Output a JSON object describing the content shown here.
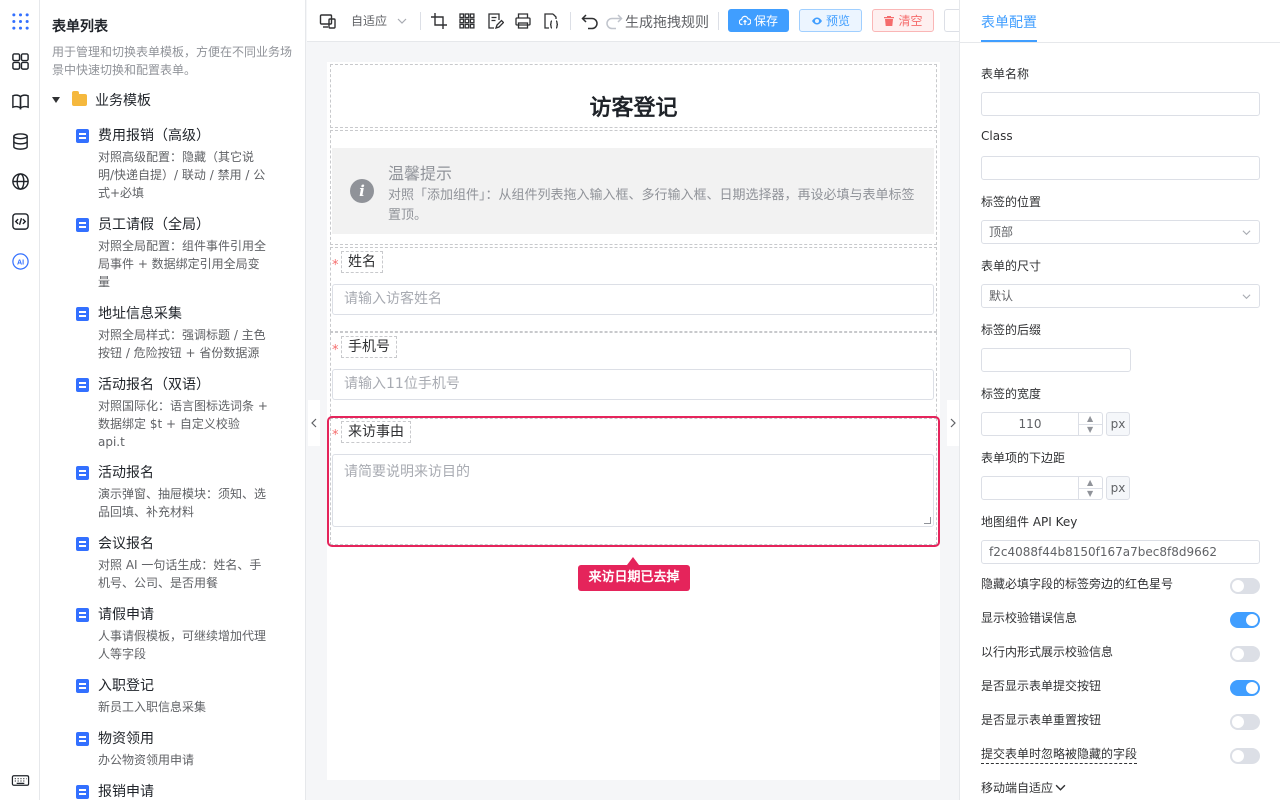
{
  "sidebar": {
    "title": "表单列表",
    "description": "用于管理和切换表单模板，方便在不同业务场景中快速切换和配置表单。",
    "folder": "业务模板",
    "templates": [
      {
        "name": "费用报销（高级）",
        "desc": "对照高级配置：隐藏（其它说明/快递自提）/ 联动 / 禁用 / 公式+必填"
      },
      {
        "name": "员工请假（全局）",
        "desc": "对照全局配置：组件事件引用全局事件 + 数据绑定引用全局变量"
      },
      {
        "name": "地址信息采集",
        "desc": "对照全局样式：强调标题 / 主色按钮 / 危险按钮 + 省份数据源"
      },
      {
        "name": "活动报名（双语）",
        "desc": "对照国际化：语言图标选词条 + 数据绑定 $t + 自定义校验 api.t"
      },
      {
        "name": "活动报名",
        "desc": "演示弹窗、抽屉模块：须知、选品回填、补充材料"
      },
      {
        "name": "会议报名",
        "desc": "对照 AI 一句话生成：姓名、手机号、公司、是否用餐"
      },
      {
        "name": "请假申请",
        "desc": "人事请假模板，可继续增加代理人等字段"
      },
      {
        "name": "入职登记",
        "desc": "新员工入职信息采集"
      },
      {
        "name": "物资领用",
        "desc": "办公物资领用申请"
      },
      {
        "name": "报销申请",
        "desc": ""
      }
    ]
  },
  "toolbar": {
    "device_mode": "自适应",
    "generate_rules": "生成拖拽规则",
    "save": "保存",
    "preview": "预览",
    "clear": "清空"
  },
  "canvas": {
    "form_title": "访客登记",
    "tip_title": "温馨提示",
    "tip_text": "对照「添加组件」：从组件列表拖入输入框、多行输入框、日期选择器，再设必填与表单标签置顶。",
    "fields": [
      {
        "label": "姓名",
        "placeholder": "请输入访客姓名",
        "required": true
      },
      {
        "label": "手机号",
        "placeholder": "请输入11位手机号",
        "required": true
      },
      {
        "label": "来访事由",
        "placeholder": "请简要说明来访目的",
        "required": true
      }
    ],
    "required_mark": "*",
    "annotation": "来访日期已去掉",
    "info_glyph": "i"
  },
  "panel": {
    "tab": "表单配置",
    "form_name_label": "表单名称",
    "form_name_value": "",
    "class_label": "Class",
    "class_value": "",
    "label_position_label": "标签的位置",
    "label_position_value": "顶部",
    "form_size_label": "表单的尺寸",
    "form_size_value": "默认",
    "label_suffix_label": "标签的后缀",
    "label_suffix_value": "",
    "label_width_label": "标签的宽度",
    "label_width_value": "110",
    "unit": "px",
    "item_margin_label": "表单项的下边距",
    "item_margin_value": "",
    "api_key_label": "地图组件 API Key",
    "api_key_value": "f2c4088f44b8150f167a7bec8f8d9662",
    "toggles": [
      {
        "label": "隐藏必填字段的标签旁边的红色星号",
        "on": false
      },
      {
        "label": "显示校验错误信息",
        "on": true
      },
      {
        "label": "以行内形式展示校验信息",
        "on": false
      },
      {
        "label": "是否显示表单提交按钮",
        "on": true
      },
      {
        "label": "是否显示表单重置按钮",
        "on": false
      },
      {
        "label": "提交表单时忽略被隐藏的字段",
        "on": false
      }
    ],
    "mobile_label": "移动端自适应"
  }
}
